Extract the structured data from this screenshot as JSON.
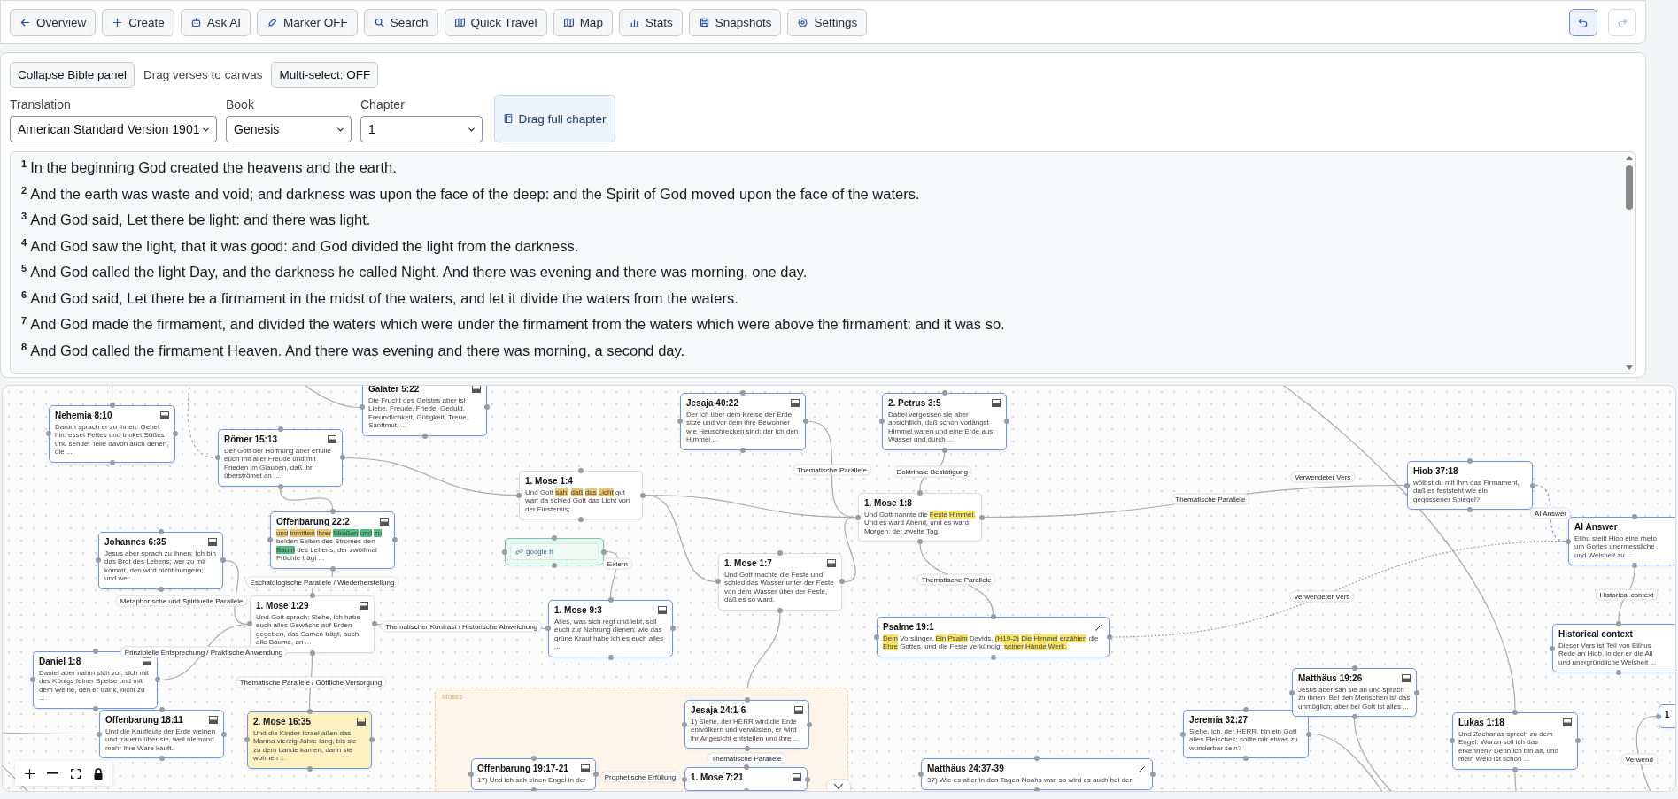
{
  "toolbar": {
    "buttons": [
      {
        "label": "Overview"
      },
      {
        "label": "Create"
      },
      {
        "label": "Ask AI"
      },
      {
        "label": "Marker OFF"
      },
      {
        "label": "Search"
      },
      {
        "label": "Quick Travel"
      },
      {
        "label": "Map"
      },
      {
        "label": "Stats"
      },
      {
        "label": "Snapshots"
      },
      {
        "label": "Settings"
      }
    ],
    "undo": {
      "disabled": false
    },
    "redo": {
      "disabled": true
    }
  },
  "bible_panel": {
    "collapse_button": "Collapse Bible panel",
    "hint": "Drag verses to canvas",
    "multi_select_button": "Multi-select: OFF",
    "fields": [
      {
        "label": "Translation",
        "value": "American Standard Version 1901"
      },
      {
        "label": "Book",
        "value": "Genesis"
      },
      {
        "label": "Chapter",
        "value": "1"
      }
    ],
    "drag_chapter_button": "Drag full chapter",
    "verses": [
      {
        "number": "1",
        "text": "In the beginning God created the heavens and the earth."
      },
      {
        "number": "2",
        "text": "And the earth was waste and void; and darkness was upon the face of the deep: and the Spirit of God moved upon the face of the waters."
      },
      {
        "number": "3",
        "text": "And God said, Let there be light: and there was light."
      },
      {
        "number": "4",
        "text": "And God saw the light, that it was good: and God divided the light from the darkness."
      },
      {
        "number": "5",
        "text": "And God called the light Day, and the darkness he called Night. And there was evening and there was morning, one day."
      },
      {
        "number": "6",
        "text": "And God said, Let there be a firmament in the midst of the waters, and let it divide the waters from the waters."
      },
      {
        "number": "7",
        "text": "And God made the firmament, and divided the waters which were under the firmament from the waters which were above the firmament: and it was so."
      },
      {
        "number": "8",
        "text": "And God called the firmament Heaven. And there was evening and there was morning, a second day."
      }
    ]
  },
  "canvas": {
    "groups": [
      {
        "label": "Mose1"
      }
    ],
    "nodes": [
      {
        "kind": "verse",
        "title": "Nehemia 8:10",
        "selected": true,
        "body": "Darum sprach er zu ihnen: Gehet hin, esset Fettes und trinket Süßes und sendet Teile davon auch denen, die ..."
      },
      {
        "kind": "verse",
        "title": "Galater 5:22",
        "selected": true,
        "body": "Die Frucht des Geistes aber ist Liebe, Freude, Friede, Geduld, Freundlichkeit, Gütigkeit, Treue, Sanftmut, ..."
      },
      {
        "kind": "verse",
        "title": "Römer 15:13",
        "selected": true,
        "body": "Der Gott der Hoffnung aber erfülle euch mit aller Freude und mit Frieden im Glauben, daß ihr überströmet an ..."
      },
      {
        "kind": "verse",
        "title": "Offenbarung 22:2",
        "selected": true,
        "segments": [
          {
            "text": "und",
            "color": "#e9c46a"
          },
          {
            "text": "inmitten",
            "color": "#e9c46a"
          },
          {
            "text": "ihrer",
            "color": "#e9c46a"
          },
          {
            "text": "Straßen",
            "color": "#4fbf7f"
          },
          {
            "text": "und",
            "color": "#4fbf7f"
          },
          {
            "text": "zu",
            "color": "#4fbf7f"
          },
          {
            "text": "beiden Seiten des Stromes den"
          },
          {
            "text": "Baum",
            "color": "#4fbf7f"
          },
          {
            "text": "des Lebens, der zwölfmal Früchte trägt ..."
          }
        ]
      },
      {
        "kind": "verse",
        "title": "Johannes 6:35",
        "selected": true,
        "body": "Jesus aber sprach zu ihnen: Ich bin das Brot des Lebens; wer zu mir kommt, den wird nicht hungern; und wer ..."
      },
      {
        "kind": "verse",
        "title": "1. Mose 1:29",
        "selected": false,
        "body": "Und Gott sprach: Siehe, ich habe euch alles Gewächs auf Erden gegeben, das Samen trägt, auch alle Bäume, an ..."
      },
      {
        "kind": "verse",
        "title": "Daniel 1:8",
        "selected": true,
        "body": "Daniel aber nahm sich vor, sich mit des Königs feiner Speise und mit dem Weine, den er trank, nicht zu ..."
      },
      {
        "kind": "verse",
        "title": "Offenbarung 18:11",
        "selected": true,
        "body": "Und die Kaufleute der Erde weinen und trauern über sie, weil niemand mehr ihre Ware kauft."
      },
      {
        "kind": "verse",
        "title": "2. Mose 16:35",
        "selected": true,
        "color": "#fdf2bf",
        "body": "Und die Kinder Israel aßen das Manna vierzig Jahre lang, bis sie zu dem Lande kamen, darin sie wohnen ..."
      },
      {
        "kind": "verse",
        "title": "1. Mose 1:4",
        "selected": false,
        "segments": [
          {
            "text": "Und Gott"
          },
          {
            "text": "sah,",
            "color": "#e9c46a"
          },
          {
            "text": "daß",
            "color": "#e9c46a"
          },
          {
            "text": "das",
            "color": "#e9c46a"
          },
          {
            "text": "Licht",
            "color": "#e9c46a"
          },
          {
            "text": "gut war; da schied Gott das Licht von der Finsternis;"
          }
        ]
      },
      {
        "kind": "link",
        "title": "google h"
      },
      {
        "kind": "verse",
        "title": "1. Mose 9:3",
        "selected": true,
        "body": "Alles, was sich regt und lebt, soll euch zur Nahrung dienen; wie das grüne Kraut habe ich es euch alles ..."
      },
      {
        "kind": "verse",
        "title": "Jesaja 40:22",
        "selected": true,
        "body": "Der ich über dem Kreise der Erde sitze und vor dem ihre Bewohner wie Heuschrecken sind; der ich den Himmel ..."
      },
      {
        "kind": "verse",
        "title": "1. Mose 1:7",
        "selected": false,
        "body": "Und Gott machte die Feste und schied das Wasser unter der Feste von dem Wasser über der Feste, daß es so ward."
      },
      {
        "kind": "verse",
        "title": "Jesaja 24:1-6",
        "selected": true,
        "body": "1) Siehe, der HERR wird die Erde entvölkern und verwüsten, er wird ihr Angesicht entstellen und ihre ..."
      },
      {
        "kind": "verse",
        "title": "Offenbarung 19:17-21",
        "selected": true,
        "body": "17) Und ich sah einen Engel in der"
      },
      {
        "kind": "verse",
        "title": "1. Mose 7:21",
        "selected": true
      },
      {
        "kind": "verse",
        "title": "2. Petrus 3:5",
        "selected": true,
        "body": "Dabei vergessen sie aber absichtlich, daß schon vorlängst Himmel waren und eine Erde aus Wasser und durch ..."
      },
      {
        "kind": "verse",
        "title": "1. Mose 1:8",
        "selected": false,
        "segments": [
          {
            "text": "Und Gott nannte die"
          },
          {
            "text": "Feste",
            "color": "#f7e463"
          },
          {
            "text": "Himmel.",
            "color": "#f7e463"
          },
          {
            "text": "Und es ward Abend, und es ward Morgen: der zweite Tag."
          }
        ]
      },
      {
        "kind": "passage",
        "title": "Psalme 19:1",
        "selected": true,
        "segments": [
          {
            "text": "Dem",
            "color": "#f7e463"
          },
          {
            "text": "Vorsänger."
          },
          {
            "text": "Ein",
            "color": "#f7e463"
          },
          {
            "text": "Psalm",
            "color": "#f7e463"
          },
          {
            "text": "Davids."
          },
          {
            "text": "(H19-2)",
            "color": "#f7e463"
          },
          {
            "text": "Die",
            "color": "#f7e463"
          },
          {
            "text": "Himmel",
            "color": "#f7e463"
          },
          {
            "text": "erzählen",
            "color": "#f7e463"
          },
          {
            "text": "die"
          },
          {
            "text": "Ehre",
            "color": "#f7e463"
          },
          {
            "text": "Gottes, und die Feste verkündigt"
          },
          {
            "text": "seiner",
            "color": "#f7e463"
          },
          {
            "text": "Hände",
            "color": "#f7e463"
          },
          {
            "text": "Werk.",
            "color": "#f7e463"
          }
        ]
      },
      {
        "kind": "passage",
        "title": "Matthäus 24:37-39",
        "selected": true,
        "body": "37) Wie es aber in den Tagen Noahs war, so wird es auch bei der"
      },
      {
        "kind": "note",
        "title": "Hiob 37:18",
        "selected": true,
        "body": "wölbst du mit ihm das Firmament, daß es feststeht wie ein gegossener Spiegel?"
      },
      {
        "kind": "note",
        "title": "AI Answer",
        "selected": true,
        "lines": [
          "Elihu stellt Hiob eine rheto",
          "um Gottes unermessliche",
          "und Weisheit zu ..."
        ]
      },
      {
        "kind": "note",
        "title": "Historical context",
        "selected": true,
        "lines": [
          "Dieser Vers ist Teil von Elihus",
          "Rede an Hiob, in der er die All",
          "und unergründliche Weisheit ..."
        ]
      },
      {
        "kind": "note",
        "title": "Jeremia 32:27",
        "selected": true,
        "body": "Siehe, ich, der HERR, bin ein Gott alles Fleisches; sollte mir etwas zu wunderbar sein?"
      },
      {
        "kind": "verse",
        "title": "Matthäus 19:26",
        "selected": true,
        "body": "Jesus aber sah sie an und sprach zu ihnen: Bei den Menschen ist das unmöglich; aber bei Gott ist alles ..."
      },
      {
        "kind": "verse",
        "title": "Lukas 1:18",
        "selected": true,
        "body": "Und Zacharias sprach zu dem Engel: Woran soll ich das erkennen? Denn ich bin alt, und mein Weib ist schon ..."
      },
      {
        "kind": "note",
        "title": "1",
        "selected": true
      }
    ],
    "edges": [
      {
        "kind": "relation",
        "label": "Eschatologische Parallele / Wiederherstellung"
      },
      {
        "kind": "relation",
        "label": "Metaphorische und Spirituelle Parallele"
      },
      {
        "kind": "relation",
        "label": "Prinzipielle Entsprechung / Praktische Anwendung"
      },
      {
        "kind": "relation",
        "label": "Thematischer Kontrast / Historische Abweichung"
      },
      {
        "kind": "relation",
        "label": "Thematische Parallele / Göttliche Versorgung"
      },
      {
        "kind": "relation",
        "label": "Extern"
      },
      {
        "kind": "relation",
        "label": "Thematische Parallele"
      },
      {
        "kind": "relation",
        "label": "Doktrinale Bestätigung"
      },
      {
        "kind": "relation",
        "label": "Thematische Parallele"
      },
      {
        "kind": "relation",
        "label": "Thematische Parallele"
      },
      {
        "kind": "relation",
        "label": "Verwendeter Vers"
      },
      {
        "kind": "ai",
        "label": "AI Answer"
      },
      {
        "kind": "reference",
        "label": "Verwendeter Vers"
      },
      {
        "kind": "relation",
        "label": "Historical context"
      },
      {
        "kind": "relation",
        "label": "Thematische Parallele"
      },
      {
        "kind": "relation",
        "label": "Prophetische Erfüllung"
      },
      {
        "kind": "relation",
        "label": "Verwend"
      }
    ]
  }
}
